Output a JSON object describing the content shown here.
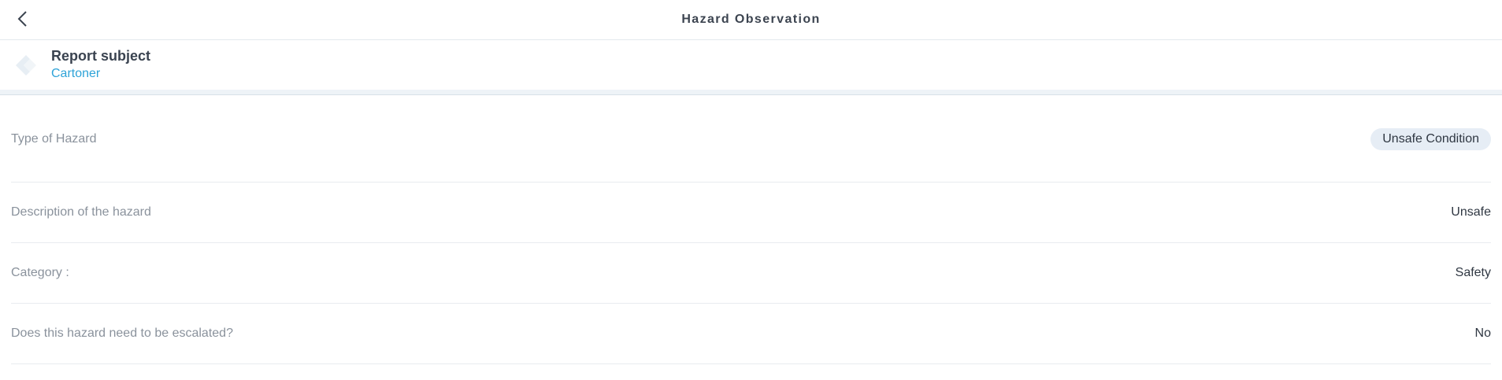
{
  "header": {
    "title": "Hazard Observation",
    "back_icon": "chevron-left-icon"
  },
  "subject": {
    "label": "Report subject",
    "value": "Cartoner",
    "icon": "report-logo-icon"
  },
  "fields": [
    {
      "label": "Type of Hazard",
      "value": "Unsafe Condition",
      "display": "chip"
    },
    {
      "label": "Description of the hazard",
      "value": "Unsafe",
      "display": "text"
    },
    {
      "label": "Category :",
      "value": "Safety",
      "display": "text"
    },
    {
      "label": "Does this hazard need to be escalated?",
      "value": "No",
      "display": "text"
    }
  ],
  "colors": {
    "accent": "#2ea3d8",
    "chip_bg": "#e6edf5",
    "label_text": "#8a929c"
  }
}
